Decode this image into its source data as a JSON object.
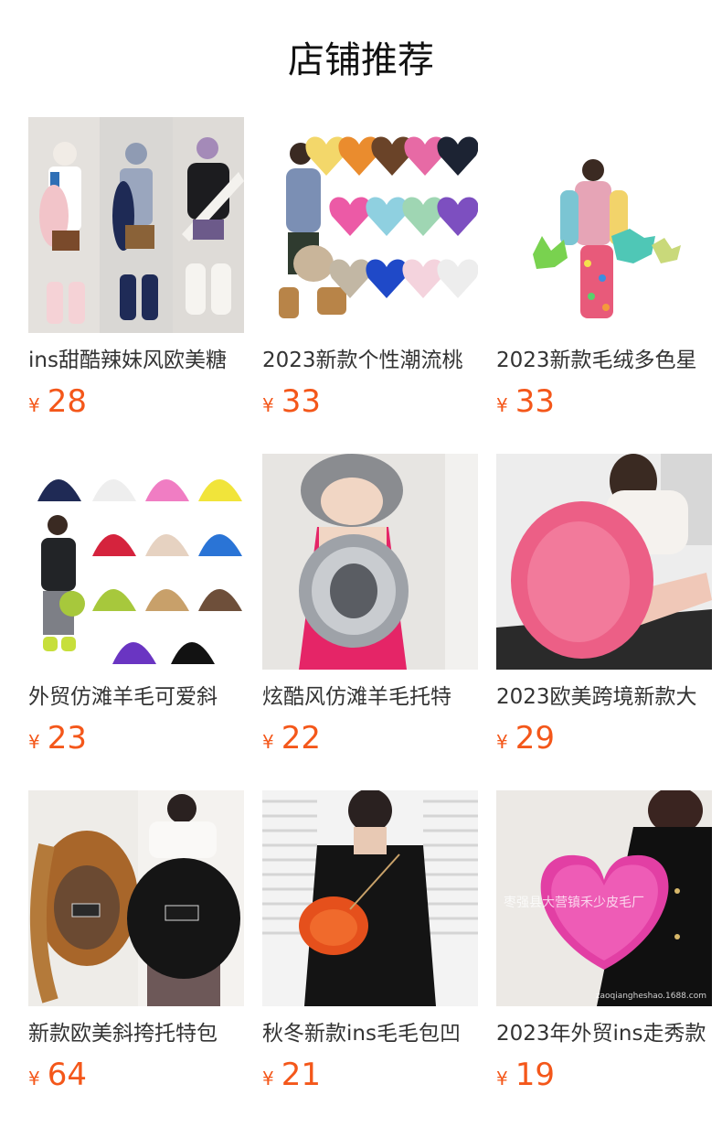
{
  "section": {
    "title": "店铺推荐"
  },
  "currency_symbol": "¥",
  "products": [
    {
      "name": "ins甜酷辣妹风欧美糖",
      "price": "28",
      "image": "fluffy-leg-warmers-models-photo"
    },
    {
      "name": "2023新款个性潮流桃",
      "price": "33",
      "image": "heart-fur-bags-color-set-photo"
    },
    {
      "name": "2023新款毛绒多色星",
      "price": "33",
      "image": "rainbow-star-bag-model-photo"
    },
    {
      "name": "外贸仿滩羊毛可爱斜",
      "price": "23",
      "image": "shaggy-bags-color-set-photo"
    },
    {
      "name": "炫酷风仿滩羊毛托特",
      "price": "22",
      "image": "silver-shaggy-tote-model-photo"
    },
    {
      "name": "2023欧美跨境新款大",
      "price": "29",
      "image": "pink-shaggy-tote-model-photo"
    },
    {
      "name": "新款欧美斜挎托特包",
      "price": "64",
      "image": "fox-fur-tote-bags-photo"
    },
    {
      "name": "秋冬新款ins毛毛包凹",
      "price": "21",
      "image": "orange-fur-crossbody-photo"
    },
    {
      "name": "2023年外贸ins走秀款",
      "price": "19",
      "image": "pink-heart-fur-bag-photo"
    }
  ],
  "watermarks": {
    "shop": "枣强县大营镇禾少皮毛厂",
    "site": "zaoqiangheshao.1688.com"
  }
}
